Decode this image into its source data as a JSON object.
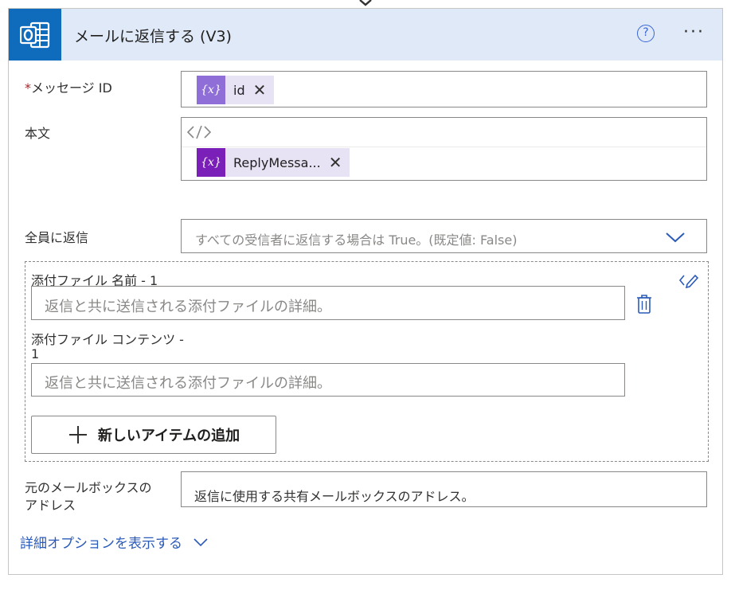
{
  "header": {
    "title": "メールに返信する (V3)",
    "help_icon": "question-circle-icon",
    "more_icon": "more-icon",
    "more_label": "···"
  },
  "fields": {
    "message_id": {
      "required_mark": "*",
      "label": "メッセージ ID",
      "token_label": "id",
      "token_color": "#8f6ed8"
    },
    "body": {
      "label": "本文",
      "code_view_icon": "code-icon",
      "token_label": "ReplyMessa...",
      "token_color": "#7a1fb8"
    },
    "reply_all": {
      "label": "全員に返信",
      "placeholder": "すべての受信者に返信する場合は True。(既定値: False)"
    },
    "attachments": {
      "name_label": "添付ファイル 名前 - 1",
      "name_placeholder": "返信と共に送信される添付ファイルの詳細。",
      "content_label_line1": "添付ファイル コンテンツ -",
      "content_label_line2": "1",
      "content_placeholder": "返信と共に送信される添付ファイルの詳細。",
      "add_button_label": "新しいアイテムの追加",
      "add_icon": "plus-icon"
    },
    "original_mailbox": {
      "label_line1": "元のメールボックスの",
      "label_line2": "アドレス",
      "placeholder": "返信に使用する共有メールボックスのアドレス。"
    }
  },
  "advanced_link": "詳細オプションを表示する",
  "colors": {
    "header_bg": "#dfe9f7",
    "app_icon_bg": "#0f6cbd",
    "accent": "#2b5bb8"
  }
}
